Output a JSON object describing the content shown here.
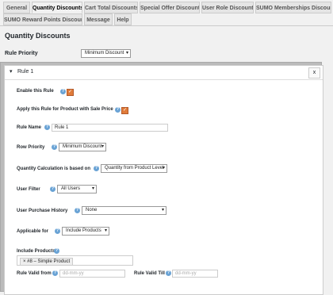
{
  "tabs": [
    {
      "label": "General"
    },
    {
      "label": "Quantity Discounts"
    },
    {
      "label": "Cart Total Discounts"
    },
    {
      "label": "Special Offer Discounts"
    },
    {
      "label": "User Role Discounts"
    },
    {
      "label": "SUMO Memberships Discounts"
    },
    {
      "label": "SUMO Reward Points Discounts"
    },
    {
      "label": "Message"
    },
    {
      "label": "Help"
    }
  ],
  "active_tab": "Quantity Discounts",
  "page_title": "Quantity Discounts",
  "rule_priority": {
    "label": "Rule Priority",
    "value": "Minimum Discount"
  },
  "rule": {
    "title": "Rule 1",
    "close": "x",
    "enable_label": "Enable this Rule",
    "apply_sale_label": "Apply this Rule for Product with Sale Price",
    "name_label": "Rule Name",
    "name_value": "Rule 1",
    "row_priority_label": "Row Priority",
    "row_priority_value": "Minimum Discount",
    "calc_label": "Quantity Calculation is based on",
    "calc_value": "Quantity from Product Level",
    "user_filter_label": "User Filter",
    "user_filter_value": "All Users",
    "purchase_history_label": "User Purchase History",
    "purchase_history_value": "None",
    "applicable_label": "Applicable for",
    "applicable_value": "Include Products",
    "include_products_label": "Include Products",
    "include_products_token": "#8 – Simple Product",
    "valid_from_label": "Rule Valid from",
    "valid_from_placeholder": "dd-mm-yy",
    "valid_till_label": "Rule Valid Till",
    "valid_till_placeholder": "dd-mm-yy"
  },
  "colors": {
    "checkbox": "#e07b39",
    "help": "#6aa3d5"
  },
  "icons": {
    "help": "help-icon",
    "checkmark": "checkmark-icon",
    "caret": "caret-down-icon",
    "remove": "remove-token-icon"
  }
}
